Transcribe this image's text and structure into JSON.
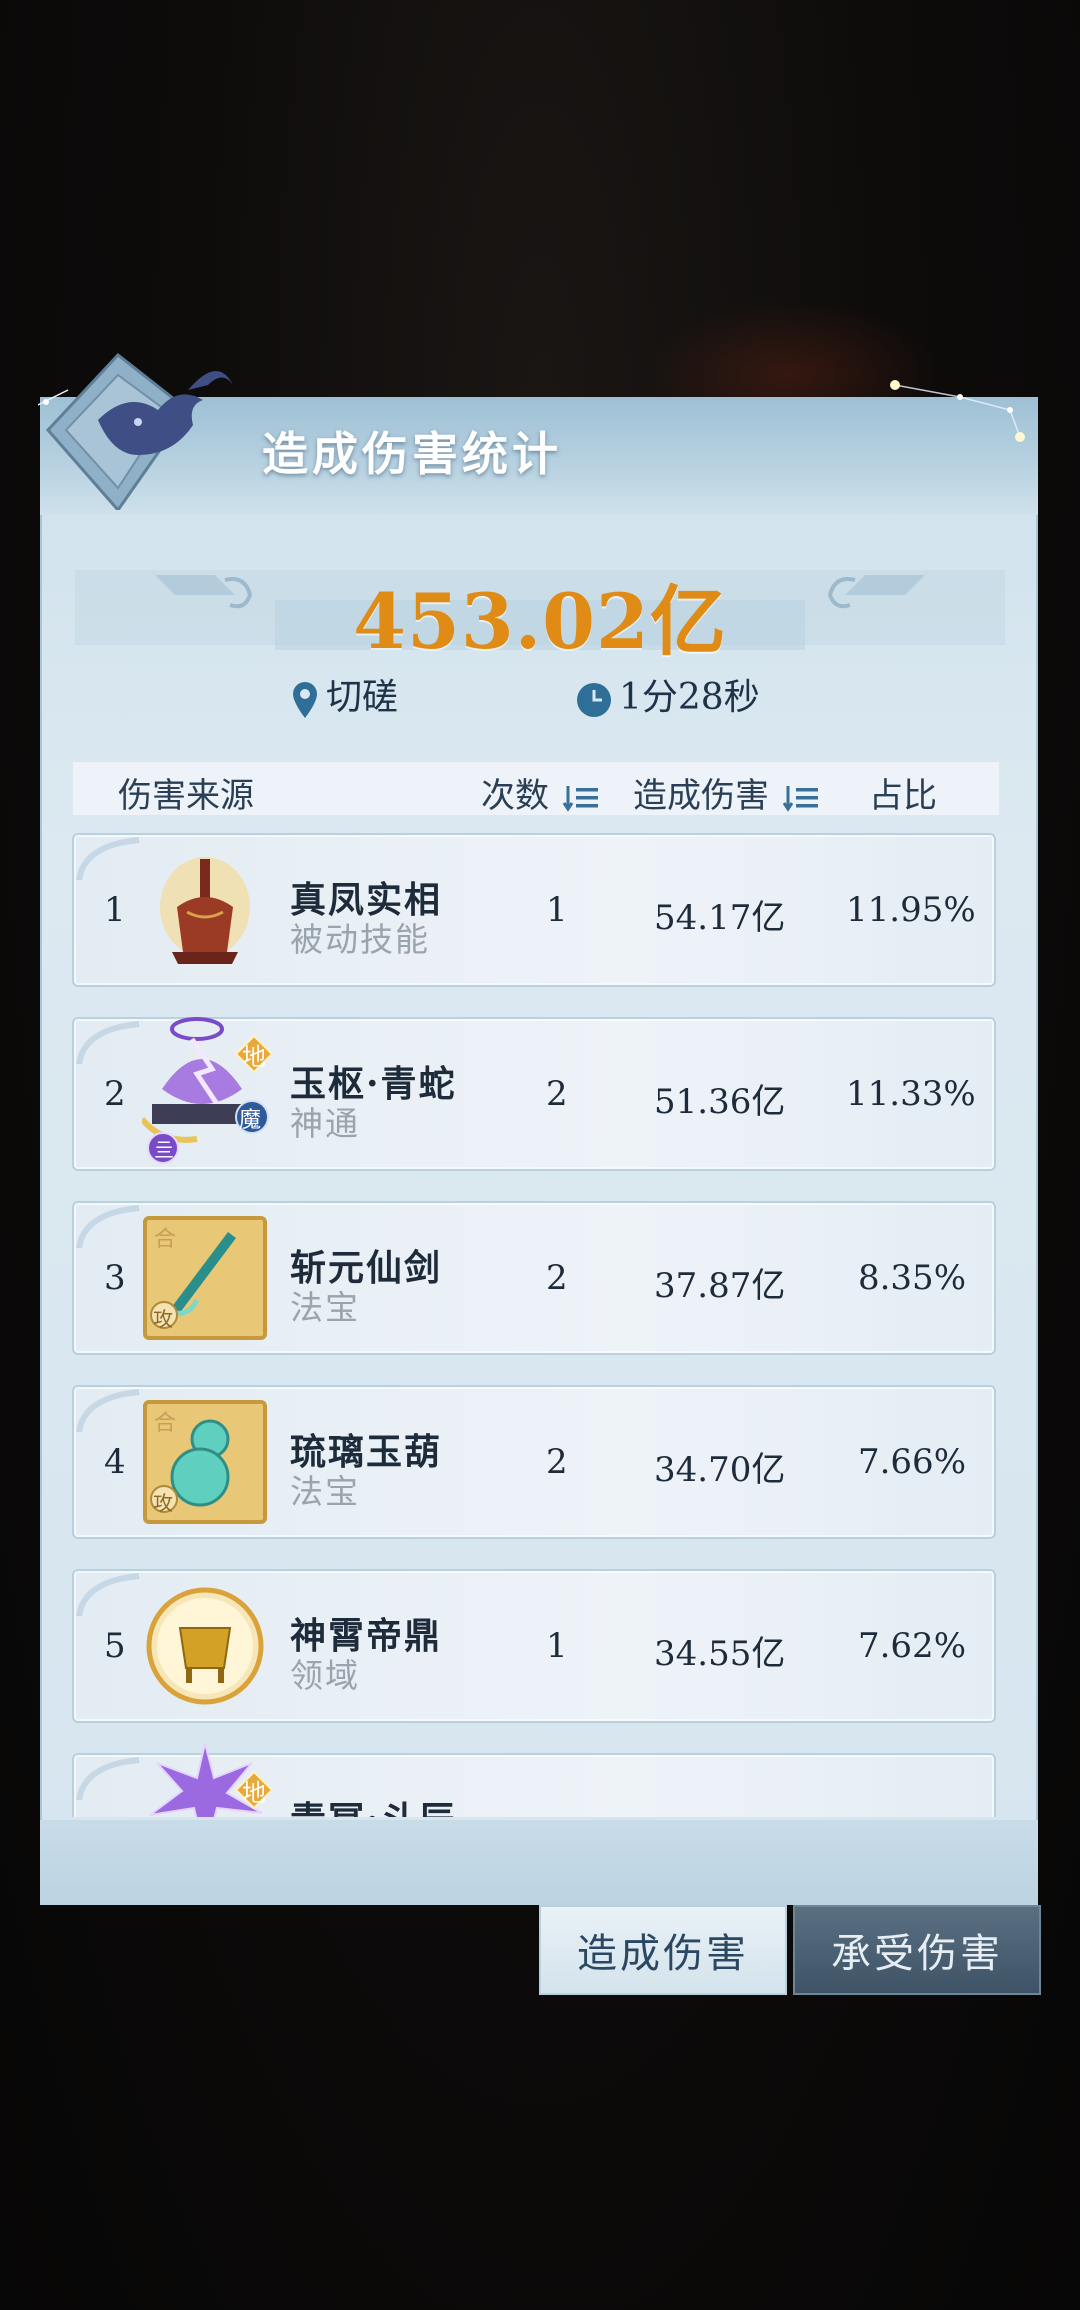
{
  "panel": {
    "title": "造成伤害统计",
    "total": "453.02亿",
    "location": "切磋",
    "duration": "1分28秒"
  },
  "table": {
    "headers": {
      "source": "伤害来源",
      "count": "次数",
      "damage": "造成伤害",
      "ratio": "占比"
    },
    "rows": [
      {
        "index": "1",
        "name": "真凤实相",
        "type": "被动技能",
        "count": "1",
        "damage": "54.17亿",
        "ratio": "11.95%",
        "icon": "phoenix-statue-icon"
      },
      {
        "index": "2",
        "name": "玉枢·青蛇",
        "type": "神通",
        "count": "2",
        "damage": "51.36亿",
        "ratio": "11.33%",
        "icon": "thunder-talisman-icon",
        "badge_top": "地",
        "badge_right": "魔",
        "badge_bottom": "亖"
      },
      {
        "index": "3",
        "name": "斩元仙剑",
        "type": "法宝",
        "count": "2",
        "damage": "37.87亿",
        "ratio": "8.35%",
        "icon": "jade-sword-icon",
        "badge_top": "合",
        "badge_bottom": "攻"
      },
      {
        "index": "4",
        "name": "琉璃玉葫",
        "type": "法宝",
        "count": "2",
        "damage": "34.70亿",
        "ratio": "7.66%",
        "icon": "jade-gourd-icon",
        "badge_top": "合",
        "badge_bottom": "攻"
      },
      {
        "index": "5",
        "name": "神霄帝鼎",
        "type": "领域",
        "count": "1",
        "damage": "34.55亿",
        "ratio": "7.62%",
        "icon": "golden-cauldron-icon"
      },
      {
        "index": "",
        "name": "青冥·斗辰",
        "type": "",
        "count": "",
        "damage": "",
        "ratio": "",
        "icon": "purple-burst-icon",
        "badge_top": "地"
      }
    ]
  },
  "tabs": {
    "dealt": "造成伤害",
    "taken": "承受伤害"
  },
  "colors": {
    "accent_orange": "#e08b16",
    "panel_blue": "#cfe1ec",
    "inactive_tab": "#4a5e72"
  }
}
